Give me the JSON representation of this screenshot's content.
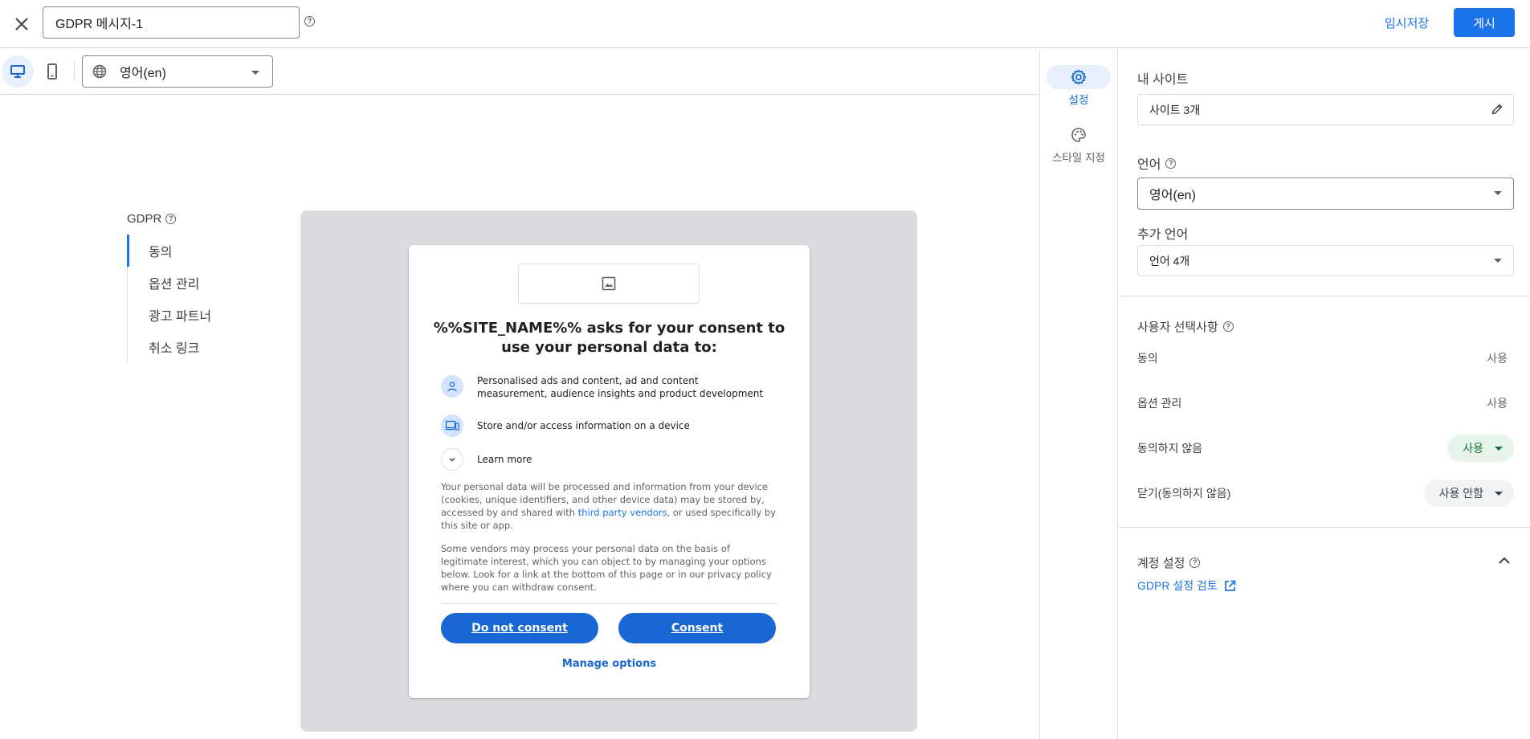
{
  "header": {
    "title_value": "GDPR 메시지-1",
    "draft_label": "임시저장",
    "publish_label": "게시"
  },
  "toolbar": {
    "language_selected": "영어(en)"
  },
  "message_nav": {
    "heading": "GDPR",
    "items": [
      {
        "label": "동의"
      },
      {
        "label": "옵션 관리"
      },
      {
        "label": "광고 파트너"
      },
      {
        "label": "취소 링크"
      }
    ]
  },
  "dialog": {
    "title": "%%SITE_NAME%% asks for your consent to use your personal data to:",
    "purposes": [
      {
        "text": "Personalised ads and content, ad and content measurement, audience insights and product development",
        "icon": "person-icon"
      },
      {
        "text": "Store and/or access information on a device",
        "icon": "devices-icon"
      },
      {
        "text": "Learn more",
        "icon": "chevron-down-icon"
      }
    ],
    "body1_before": "Your personal data will be processed and information from your device (cookies, unique identifiers, and other device data) may be stored by, accessed by and shared with ",
    "body1_link": "third party vendors",
    "body1_after": ", or used specifically by this site or app.",
    "body2": "Some vendors may process your personal data on the basis of legitimate interest, which you can object to by managing your options below. Look for a link at the bottom of this page or in our privacy policy where you can withdraw consent.",
    "do_not_consent": "Do not consent",
    "consent": "Consent",
    "manage_options": "Manage options"
  },
  "rail": {
    "settings_label": "설정",
    "style_label": "스타일 지정"
  },
  "panel": {
    "my_sites_label": "내 사이트",
    "my_sites_value": "사이트 3개",
    "language_label": "언어",
    "language_value": "영어(en)",
    "additional_languages_label": "추가 언어",
    "additional_languages_value": "언어 4개",
    "user_choices_label": "사용자 선택사항",
    "choices": [
      {
        "label": "동의",
        "value": "사용"
      },
      {
        "label": "옵션 관리",
        "value": "사용"
      },
      {
        "label": "동의하지 않음",
        "value": "사용"
      },
      {
        "label": "닫기(동의하지 않음)",
        "value": "사용 안함"
      }
    ],
    "account_settings_label": "계정 설정",
    "review_link": "GDPR 설정 검토"
  },
  "colors": {
    "accent": "#1a73e8",
    "dialog_button": "#1967d2",
    "chip_on_bg": "#e6f4ea",
    "chip_on_text": "#137333",
    "canvas_bg": "#dadce0"
  }
}
